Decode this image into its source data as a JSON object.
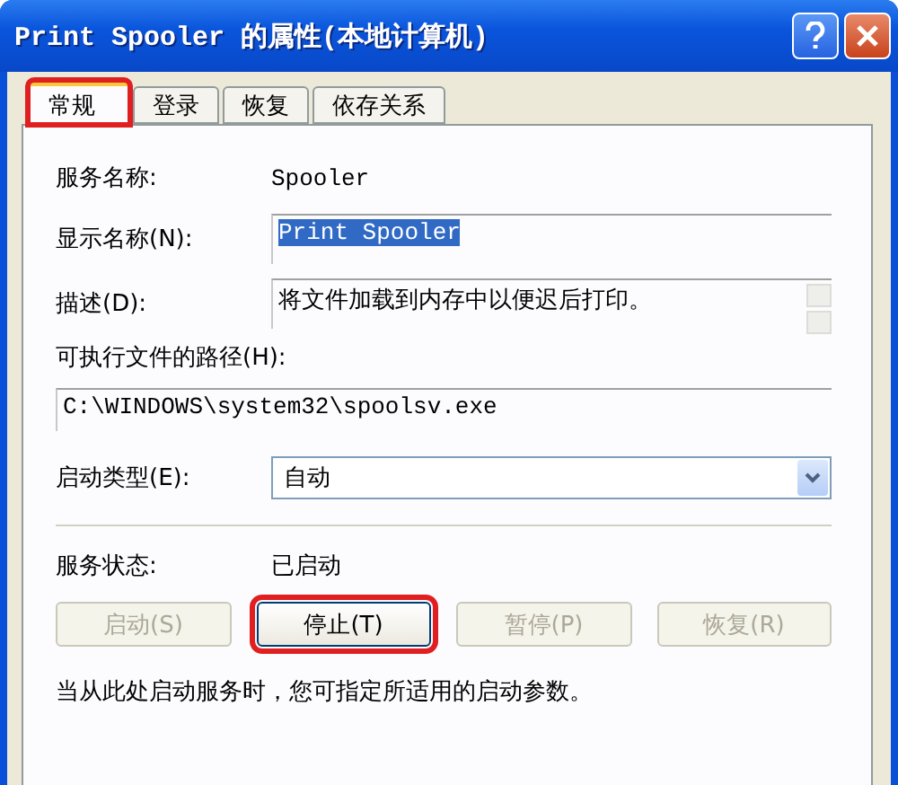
{
  "window": {
    "title": "Print Spooler 的属性(本地计算机)"
  },
  "tabs": [
    {
      "label": "常规",
      "selected": true,
      "highlighted": true
    },
    {
      "label": "登录",
      "selected": false,
      "highlighted": false
    },
    {
      "label": "恢复",
      "selected": false,
      "highlighted": false
    },
    {
      "label": "依存关系",
      "selected": false,
      "highlighted": false
    }
  ],
  "service_name": {
    "label": "服务名称:",
    "value": "Spooler"
  },
  "display_name": {
    "label": "显示名称(N):",
    "value": "Print Spooler",
    "selected": true
  },
  "description": {
    "label": "描述(D):",
    "value": "将文件加载到内存中以便迟后打印。"
  },
  "executable_path": {
    "label": "可执行文件的路径(H):",
    "value": "C:\\WINDOWS\\system32\\spoolsv.exe"
  },
  "startup_type": {
    "label": "启动类型(E):",
    "value": "自动"
  },
  "service_status": {
    "label": "服务状态:",
    "value": "已启动"
  },
  "buttons": [
    {
      "label": "启动(S)",
      "disabled": true,
      "highlighted": false
    },
    {
      "label": "停止(T)",
      "disabled": false,
      "highlighted": true
    },
    {
      "label": "暂停(P)",
      "disabled": true,
      "highlighted": false
    },
    {
      "label": "恢复(R)",
      "disabled": true,
      "highlighted": false
    }
  ],
  "note": "当从此处启动服务时，您可指定所适用的启动参数。"
}
